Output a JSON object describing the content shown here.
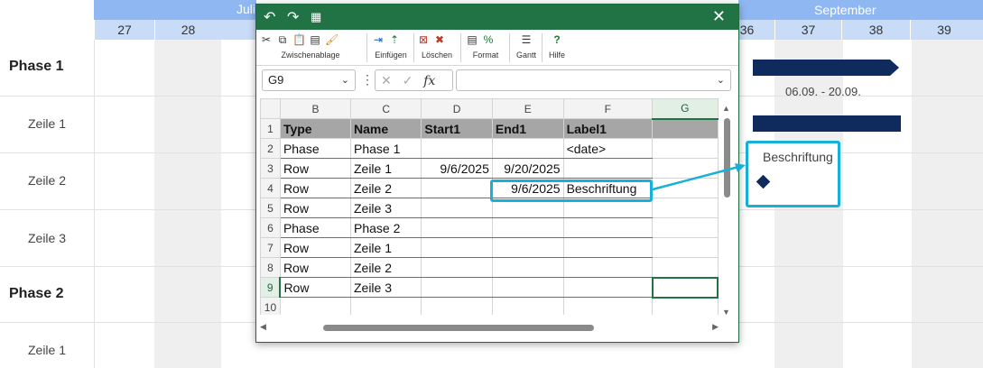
{
  "gantt": {
    "months": [
      {
        "label": "Juli"
      },
      {
        "label": "September"
      }
    ],
    "weeks": [
      "27",
      "28",
      "36",
      "37",
      "38",
      "39"
    ],
    "rows": [
      {
        "label": "Phase 1",
        "kind": "phase"
      },
      {
        "label": "Zeile 1",
        "kind": "row"
      },
      {
        "label": "Zeile 2",
        "kind": "row"
      },
      {
        "label": "Zeile 3",
        "kind": "row"
      },
      {
        "label": "Phase 2",
        "kind": "phase"
      },
      {
        "label": "Zeile 1",
        "kind": "row"
      }
    ],
    "phase1_dates": "06.09. - 20.09.",
    "annotation": "Beschriftung",
    "bar_color": "#0f2a5c",
    "highlight_color": "#17b0d9"
  },
  "excel": {
    "ribbon": {
      "groups": [
        "Zwischenablage",
        "Einfügen",
        "Löschen",
        "Format",
        "Gantt",
        "Hilfe"
      ]
    },
    "name_box": "G9",
    "fx_label": "fx",
    "columns": [
      "B",
      "C",
      "D",
      "E",
      "F",
      "G"
    ],
    "row_numbers": [
      "1",
      "2",
      "3",
      "4",
      "5",
      "6",
      "7",
      "8",
      "9",
      "10"
    ],
    "header": [
      "Type",
      "Name",
      "Start1",
      "End1",
      "Label1",
      ""
    ],
    "rows": [
      [
        "Phase",
        "Phase 1",
        "",
        "",
        "<date>",
        ""
      ],
      [
        "Row",
        "Zeile 1",
        "9/6/2025",
        "9/20/2025",
        "",
        ""
      ],
      [
        "Row",
        "Zeile 2",
        "",
        "9/6/2025",
        "Beschriftung",
        ""
      ],
      [
        "Row",
        "Zeile 3",
        "",
        "",
        "",
        ""
      ],
      [
        "Phase",
        "Phase 2",
        "",
        "",
        "",
        ""
      ],
      [
        "Row",
        "Zeile 1",
        "",
        "",
        "",
        ""
      ],
      [
        "Row",
        "Zeile 2",
        "",
        "",
        "",
        ""
      ],
      [
        "Row",
        "Zeile 3",
        "",
        "",
        "",
        ""
      ],
      [
        "",
        "",
        "",
        "",
        "",
        ""
      ]
    ],
    "accent": "#217346"
  }
}
